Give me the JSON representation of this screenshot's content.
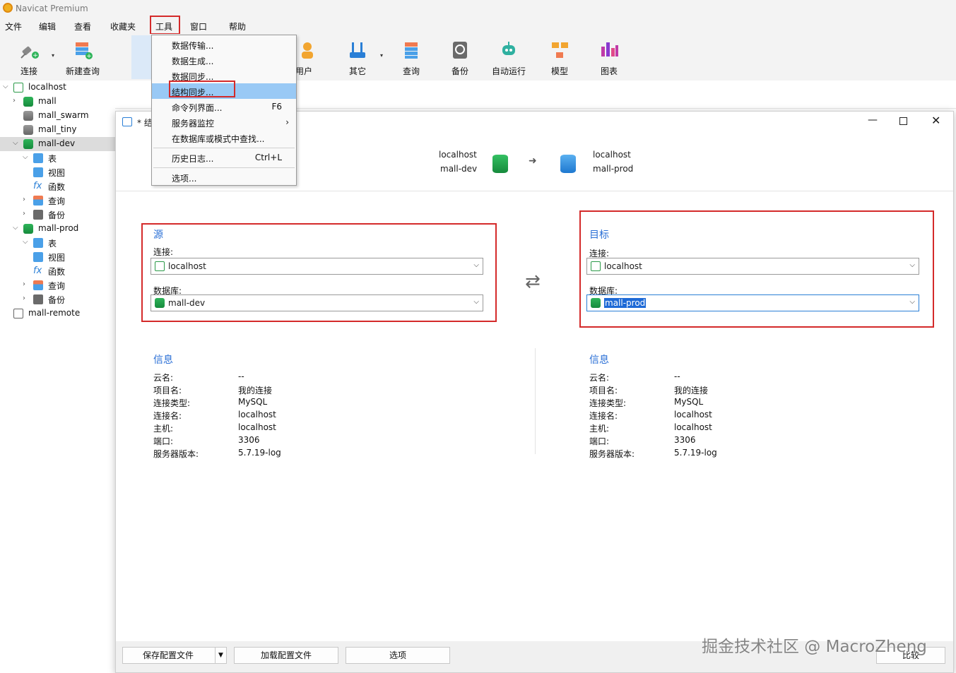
{
  "app": {
    "title": "Navicat Premium"
  },
  "menubar": {
    "items": [
      "文件",
      "编辑",
      "查看",
      "收藏夹",
      "工具",
      "窗口",
      "帮助"
    ]
  },
  "toolbar": {
    "connect": "连接",
    "new_query": "新建查询",
    "user": "用户",
    "other": "其它",
    "query": "查询",
    "backup": "备份",
    "auto_run": "自动运行",
    "model": "模型",
    "chart": "图表"
  },
  "sidebar": {
    "items": [
      {
        "label": "localhost"
      },
      {
        "label": "mall"
      },
      {
        "label": "mall_swarm"
      },
      {
        "label": "mall_tiny"
      },
      {
        "label": "mall-dev"
      },
      {
        "label": "表"
      },
      {
        "label": "视图"
      },
      {
        "label": "函数"
      },
      {
        "label": "查询"
      },
      {
        "label": "备份"
      },
      {
        "label": "mall-prod"
      },
      {
        "label": "表"
      },
      {
        "label": "视图"
      },
      {
        "label": "函数"
      },
      {
        "label": "查询"
      },
      {
        "label": "备份"
      },
      {
        "label": "mall-remote"
      }
    ]
  },
  "tools_menu": {
    "items": [
      {
        "label": "数据传输..."
      },
      {
        "label": "数据生成..."
      },
      {
        "label": "数据同步..."
      },
      {
        "label": "结构同步..."
      },
      {
        "label": "命令列界面...",
        "shortcut": "F6"
      },
      {
        "label": "服务器监控"
      },
      {
        "label": "在数据库或模式中查找..."
      },
      {
        "label": "历史日志...",
        "shortcut": "Ctrl+L"
      },
      {
        "label": "选项..."
      }
    ]
  },
  "dialog": {
    "title": "* 结",
    "header": {
      "source_conn": "localhost",
      "source_db": "mall-dev",
      "target_conn": "localhost",
      "target_db": "mall-prod"
    },
    "source": {
      "title": "源",
      "conn_label": "连接:",
      "conn_value": "localhost",
      "db_label": "数据库:",
      "db_value": "mall-dev"
    },
    "target": {
      "title": "目标",
      "conn_label": "连接:",
      "conn_value": "localhost",
      "db_label": "数据库:",
      "db_value": "mall-prod"
    },
    "source_info": {
      "title": "信息",
      "rows": [
        {
          "k": "云名:",
          "v": "--"
        },
        {
          "k": "项目名:",
          "v": "我的连接"
        },
        {
          "k": "连接类型:",
          "v": "MySQL"
        },
        {
          "k": "连接名:",
          "v": "localhost"
        },
        {
          "k": "主机:",
          "v": "localhost"
        },
        {
          "k": "端口:",
          "v": "3306"
        },
        {
          "k": "服务器版本:",
          "v": "5.7.19-log"
        }
      ]
    },
    "target_info": {
      "title": "信息",
      "rows": [
        {
          "k": "云名:",
          "v": "--"
        },
        {
          "k": "项目名:",
          "v": "我的连接"
        },
        {
          "k": "连接类型:",
          "v": "MySQL"
        },
        {
          "k": "连接名:",
          "v": "localhost"
        },
        {
          "k": "主机:",
          "v": "localhost"
        },
        {
          "k": "端口:",
          "v": "3306"
        },
        {
          "k": "服务器版本:",
          "v": "5.7.19-log"
        }
      ]
    },
    "footer": {
      "save_config": "保存配置文件",
      "load_config": "加载配置文件",
      "options": "选项",
      "compare": "比较"
    }
  },
  "watermark": "掘金技术社区 @ MacroZheng",
  "colors": {
    "highlight": "#99c9f5",
    "annotation_red": "#d42a2a",
    "section_blue": "#2a6fd6",
    "db_green": "#1f9e48",
    "db_blue": "#2a8fe0"
  }
}
